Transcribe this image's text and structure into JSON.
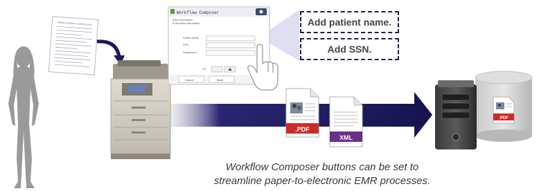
{
  "document": {
    "title": "Medical History Questionnaire"
  },
  "screen": {
    "app_title": "Workflow Composer",
    "subtitle_line1": "Index information",
    "subtitle_line2": "Enter index information.",
    "fields": [
      {
        "label": "Patient Name"
      },
      {
        "label": "SSN"
      },
      {
        "label": "Department"
      }
    ],
    "page_indicator": "1/2",
    "cancel_label": "Cancel",
    "back_label": "Back"
  },
  "callouts": {
    "patient_name": "Add patient name.",
    "ssn": "Add SSN."
  },
  "files": {
    "pdf_label": ".PDF",
    "xml_label": "XML",
    "server_pdf_label": ".PDF"
  },
  "caption": {
    "line1": "Workflow Composer buttons can be set to",
    "line2": "streamline paper-to-electronic EMR processes."
  },
  "colors": {
    "arrow": "#1e1a5a",
    "pdf_red": "#cf2a2a",
    "xml_purple": "#6a2f86",
    "callout_border": "#1a1a5e"
  }
}
